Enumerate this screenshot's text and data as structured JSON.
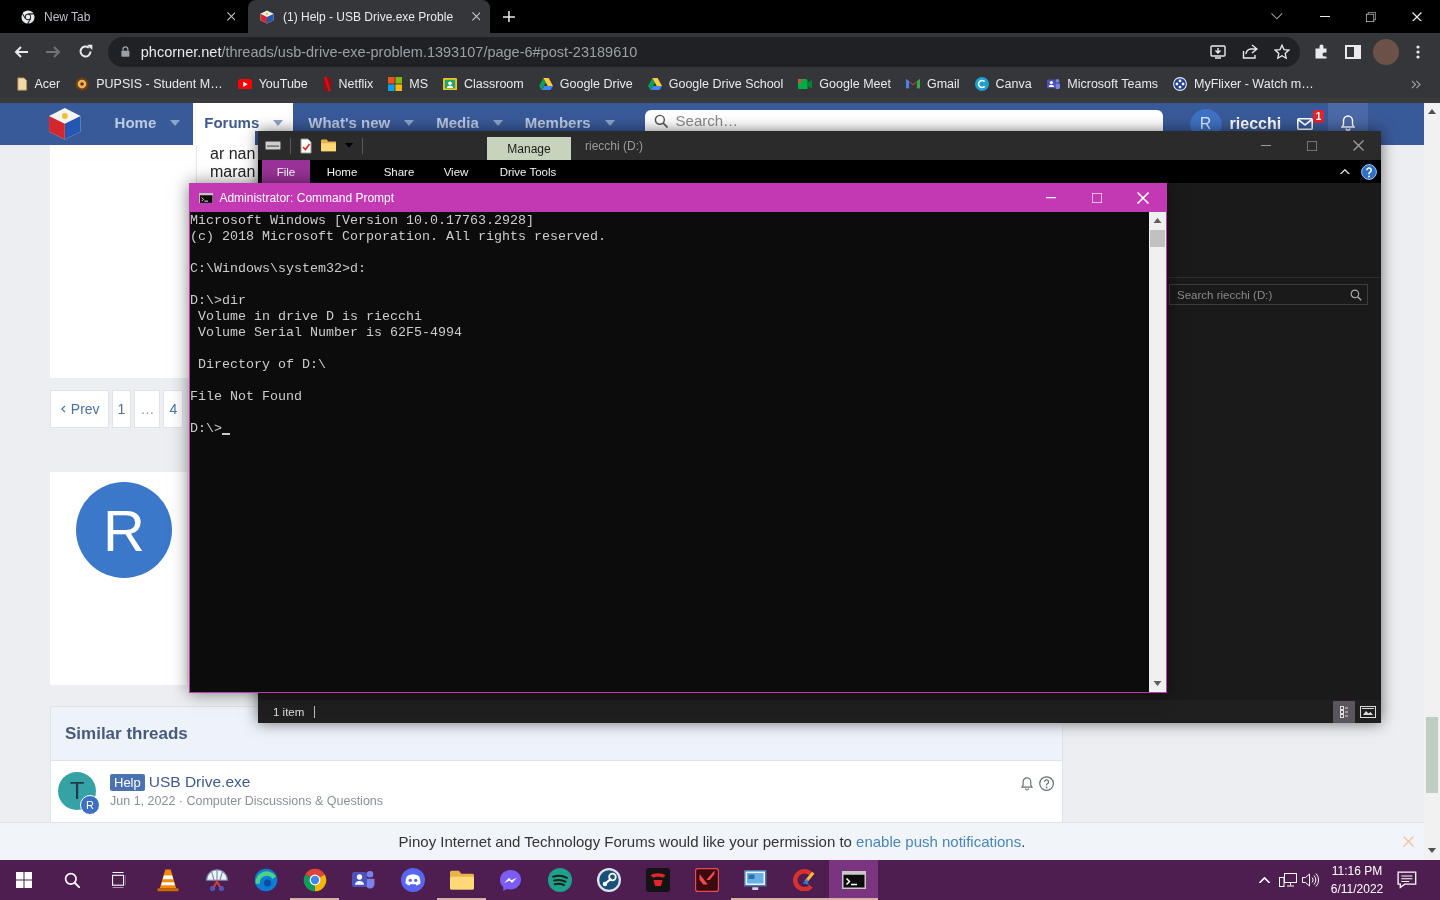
{
  "browser": {
    "tabs": [
      {
        "title": "New Tab",
        "kind": "newtab",
        "selected": false
      },
      {
        "title": "(1) Help - USB Drive.exe Proble",
        "kind": "site",
        "selected": true
      }
    ],
    "nav_buttons": [
      {
        "kind": "back",
        "disabled": false
      },
      {
        "kind": "forward",
        "disabled": true
      },
      {
        "kind": "reload",
        "disabled": false
      }
    ],
    "address": {
      "host": "phcorner.net",
      "path": "/threads/usb-drive-exe-problem.1393107/page-6#post-23189610"
    },
    "bookmarks": [
      {
        "label": "Acer",
        "kind": "page"
      },
      {
        "label": "PUPSIS - Student M…",
        "kind": "seal"
      },
      {
        "label": "YouTube",
        "kind": "play"
      },
      {
        "label": "Netflix",
        "kind": "ribbon"
      },
      {
        "label": "MS",
        "kind": "squares"
      },
      {
        "label": "Classroom",
        "kind": "board"
      },
      {
        "label": "Google Drive",
        "kind": "triangle"
      },
      {
        "label": "Google Drive School",
        "kind": "triangle"
      },
      {
        "label": "Google Meet",
        "kind": "camera"
      },
      {
        "label": "Gmail",
        "kind": "mail"
      },
      {
        "label": "Canva",
        "kind": "arc"
      },
      {
        "label": "Microsoft Teams",
        "kind": "people"
      },
      {
        "label": "MyFlixer - Watch m…",
        "kind": "reel"
      }
    ]
  },
  "forum": {
    "nav": [
      {
        "label": "Home",
        "selected": false
      },
      {
        "label": "Forums",
        "selected": true
      },
      {
        "label": "What's new",
        "selected": false
      },
      {
        "label": "Media",
        "selected": false
      },
      {
        "label": "Members",
        "selected": false
      }
    ],
    "search": {
      "placeholder": "Search…"
    },
    "user": {
      "initial": "R",
      "name": "riecchi",
      "unread": "1"
    },
    "post_text": [
      "ar nan",
      "maran"
    ],
    "pagination": [
      {
        "label": "Prev",
        "kind": "prev"
      },
      {
        "label": "1",
        "kind": "page"
      },
      {
        "label": "…",
        "kind": "gap"
      },
      {
        "label": "4",
        "kind": "page"
      }
    ],
    "post_avatar": "R",
    "similar": {
      "title": "Similar threads",
      "threads": [
        {
          "avatar": "T",
          "badge": "R",
          "prefix": "Help",
          "title": "USB Drive.exe",
          "meta": "Jun 1, 2022 · Computer Discussions & Questions"
        }
      ]
    },
    "notice": {
      "text": "Pinoy Internet and Technology Forums would like your permission to",
      "link": "enable push notifications",
      "tail": "."
    }
  },
  "explorer": {
    "title": "riecchi (D:)",
    "context_tab": "Manage",
    "ribbon": [
      {
        "label": "File",
        "kind": "file"
      },
      {
        "label": "Home",
        "kind": "tab"
      },
      {
        "label": "Share",
        "kind": "tab"
      },
      {
        "label": "View",
        "kind": "tab"
      },
      {
        "label": "Drive Tools",
        "kind": "context"
      }
    ],
    "search": {
      "placeholder": "Search riecchi (D:)"
    },
    "status": "1 item",
    "views": [
      {
        "kind": "details",
        "selected": true
      },
      {
        "kind": "tiles",
        "selected": false
      }
    ]
  },
  "console": {
    "title": "Administrator: Command Prompt",
    "blocks": [
      [
        "Microsoft Windows [Version 10.0.17763.2928]",
        "(c) 2018 Microsoft Corporation. All rights reserved."
      ],
      [
        "C:\\Windows\\system32>d:"
      ],
      [
        "D:\\>dir",
        " Volume in drive D is riecchi",
        " Volume Serial Number is 62F5-4994"
      ],
      [
        " Directory of D:\\"
      ],
      [
        "File Not Found"
      ],
      [
        "D:\\>"
      ]
    ]
  },
  "taskbar": {
    "apps": [
      {
        "kind": "cone",
        "running": false,
        "active": false
      },
      {
        "kind": "umbrella",
        "running": false,
        "active": false
      },
      {
        "kind": "swirl",
        "running": false,
        "active": false
      },
      {
        "kind": "tricolor",
        "running": true,
        "active": false
      },
      {
        "kind": "people",
        "running": false,
        "active": false
      },
      {
        "kind": "controller",
        "running": false,
        "active": false
      },
      {
        "kind": "folder",
        "running": true,
        "active": false
      },
      {
        "kind": "bubble",
        "running": false,
        "active": false
      },
      {
        "kind": "waves",
        "running": false,
        "active": false
      },
      {
        "kind": "knob",
        "running": false,
        "active": false
      },
      {
        "kind": "emblem",
        "running": false,
        "active": false
      },
      {
        "kind": "fang",
        "running": false,
        "active": false
      },
      {
        "kind": "monitor",
        "running": true,
        "active": false
      },
      {
        "kind": "brush",
        "running": true,
        "active": false
      },
      {
        "kind": "terminal",
        "running": true,
        "active": true
      }
    ],
    "time": "11:16 PM",
    "date": "6/11/2022"
  }
}
